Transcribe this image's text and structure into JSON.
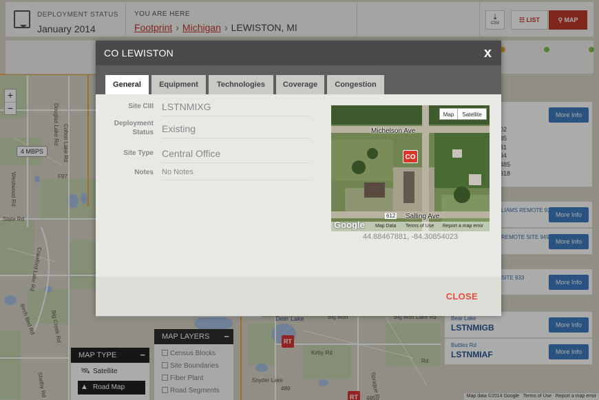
{
  "header": {
    "deployment_status_label": "DEPLOYMENT STATUS",
    "deployment_status_value": "January 2014",
    "you_are_here_label": "YOU ARE HERE",
    "breadcrumbs": [
      "Footprint",
      "Michigan",
      "LEWISTON, MI"
    ],
    "csv_label": "CSV",
    "list_label": "LIST",
    "map_label": "MAP"
  },
  "map": {
    "zoom_in": "+",
    "zoom_out": "−",
    "speed_bubble": "4 MBPS",
    "road_labels": [
      "Douglas Lake Rd",
      "Westwood Rd",
      "F97",
      "State Rd",
      "Cohon Lake Rd",
      "Crawford Lake Rd",
      "Birch Bed Rd",
      "Big Creek Rd",
      "Shelby Rd",
      "Big Wolf",
      "Big Wolf Lake Rd",
      "Snyder Lake",
      "Kirby Rd",
      "Sprague Rd",
      "Rd",
      "Deer Lake",
      "Bear Lake",
      "489",
      "485"
    ],
    "rt_pin": "RT",
    "attribution": [
      "Map data ©2014 Google",
      "Terms of Use",
      "Report a map error"
    ]
  },
  "sitelist": {
    "partial_numbers": [
      "02",
      "35",
      "31",
      "94",
      "485",
      "318"
    ],
    "items": [
      {
        "loc": "",
        "code": "",
        "more": "More Info"
      },
      {
        "loc": "LIAMS REMOTE 92",
        "code": "",
        "more": "More Info"
      },
      {
        "loc": "REMOTE SITE 949",
        "code": "",
        "more": "More Info"
      },
      {
        "loc": "SITE 933",
        "code": "",
        "more": "More Info"
      },
      {
        "loc": "Bear Lake",
        "code": "LSTNMIGB",
        "more": "More Info"
      },
      {
        "loc": "Buttles Rd",
        "code": "LSTNMIAF",
        "more": "More Info"
      }
    ]
  },
  "map_type": {
    "title": "MAP TYPE",
    "minimize": "−",
    "options": [
      {
        "label": "Satellite",
        "icon": "satellite-icon"
      },
      {
        "label": "Road Map",
        "icon": "road-icon"
      }
    ],
    "selected": "Road Map"
  },
  "map_layers": {
    "title": "MAP LAYERS",
    "minimize": "−",
    "options": [
      "Census Blocks",
      "Site Boundaries",
      "Fiber Plant",
      "Road Segments"
    ]
  },
  "modal": {
    "title": "CO LEWISTON",
    "close_x": "x",
    "tabs": [
      "General",
      "Equipment",
      "Technologies",
      "Coverage",
      "Congestion"
    ],
    "active_tab": "General",
    "fields": [
      {
        "label": "Site CIII",
        "value": "LSTNMIXG"
      },
      {
        "label": "Deployment Status",
        "value": "Existing"
      },
      {
        "label": "Site Type",
        "value": "Central Office"
      },
      {
        "label": "Notes",
        "value": "No Notes"
      }
    ],
    "minimap": {
      "map_toggle": "Map",
      "satellite_toggle": "Satellite",
      "streets": [
        "Michelson Ave",
        "Salling Ave"
      ],
      "route_shield": "612",
      "pin": "CO",
      "google": "Google",
      "footer": [
        "Map Data",
        "Terms of Use",
        "Report a map error"
      ]
    },
    "coordinates": "44.88467881, -84.30854023",
    "close_button": "CLOSE"
  },
  "colors": {
    "accent_red": "#c0392b",
    "close_red": "#e74c3c",
    "more_info_blue": "#3f7cc0",
    "modal_header": "#4a4a4a"
  }
}
